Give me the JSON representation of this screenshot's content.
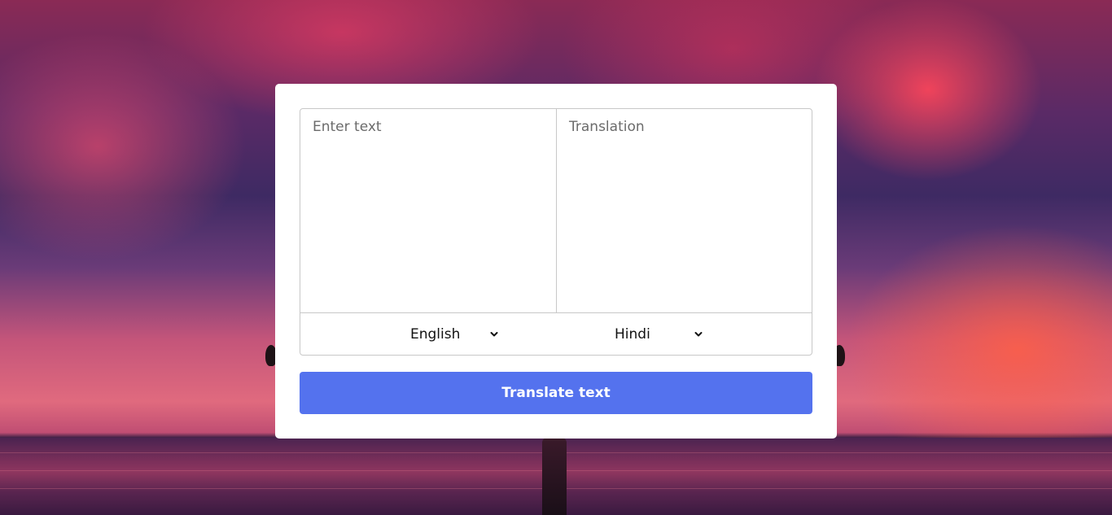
{
  "source": {
    "placeholder": "Enter text",
    "value": ""
  },
  "target": {
    "placeholder": "Translation",
    "value": ""
  },
  "languages": {
    "from_selected": "English",
    "to_selected": "Hindi"
  },
  "actions": {
    "translate_label": "Translate text"
  },
  "icons": {
    "dropdown": "chevron-down-icon"
  },
  "colors": {
    "button_bg": "#5472ee",
    "button_text": "#ffffff",
    "card_bg": "#ffffff",
    "border": "#c8c8c8"
  }
}
